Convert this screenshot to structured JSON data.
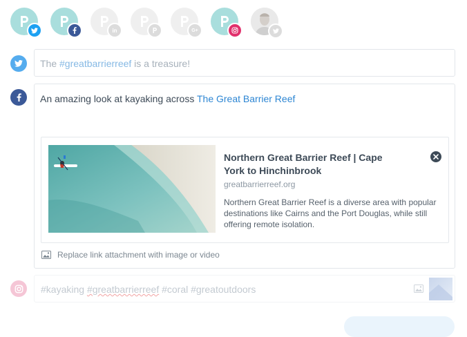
{
  "accounts": [
    {
      "network": "twitter",
      "active": true,
      "icon": "pinterest-p-logo-icon",
      "badge_icon": "twitter-badge-icon",
      "badge_color": "#1da1f2"
    },
    {
      "network": "facebook",
      "active": true,
      "icon": "pinterest-p-logo-icon",
      "badge_icon": "facebook-badge-icon",
      "badge_color": "#3b5998"
    },
    {
      "network": "linkedin",
      "active": false,
      "icon": "pinterest-p-logo-icon",
      "badge_icon": "linkedin-badge-icon"
    },
    {
      "network": "pinterest",
      "active": false,
      "icon": "pinterest-p-logo-icon",
      "badge_icon": "pinterest-badge-icon"
    },
    {
      "network": "google-plus",
      "active": false,
      "icon": "pinterest-p-logo-icon",
      "badge_icon": "google-plus-badge-icon",
      "badge_text": "G+"
    },
    {
      "network": "instagram",
      "active": true,
      "icon": "pinterest-p-logo-icon",
      "badge_icon": "instagram-badge-icon",
      "badge_color": "#e1306c"
    },
    {
      "network": "twitter-personal",
      "active": false,
      "icon": "user-avatar-icon",
      "badge_icon": "twitter-badge-icon"
    }
  ],
  "colors": {
    "twitter": "#55acee",
    "facebook": "#3b5998",
    "instagram": "#e1306c",
    "active_account_bg": "#a9dedd",
    "link": "#2d86d3"
  },
  "twitter_post": {
    "prefix": "The ",
    "hashtag": "#greatbarrierreef",
    "suffix": " is a treasure!"
  },
  "facebook_post": {
    "text": "An amazing look at kayaking across ",
    "link_text": "The Great Barrier Reef",
    "preview": {
      "title": "Northern Great Barrier Reef | Cape York to Hinchinbrook",
      "domain": "greatbarrierreef.org",
      "description": "Northern Great Barrier Reef is a diverse area with popular destinations like Cairns and the Port Douglas, while still offering remote isolation."
    },
    "replace_label": "Replace link attachment with image or video"
  },
  "instagram_post": {
    "tag1": "#kayaking",
    "tag2": "#greatbarrierreef",
    "tag3": "#coral",
    "tag4": "#greatoutdoors"
  }
}
